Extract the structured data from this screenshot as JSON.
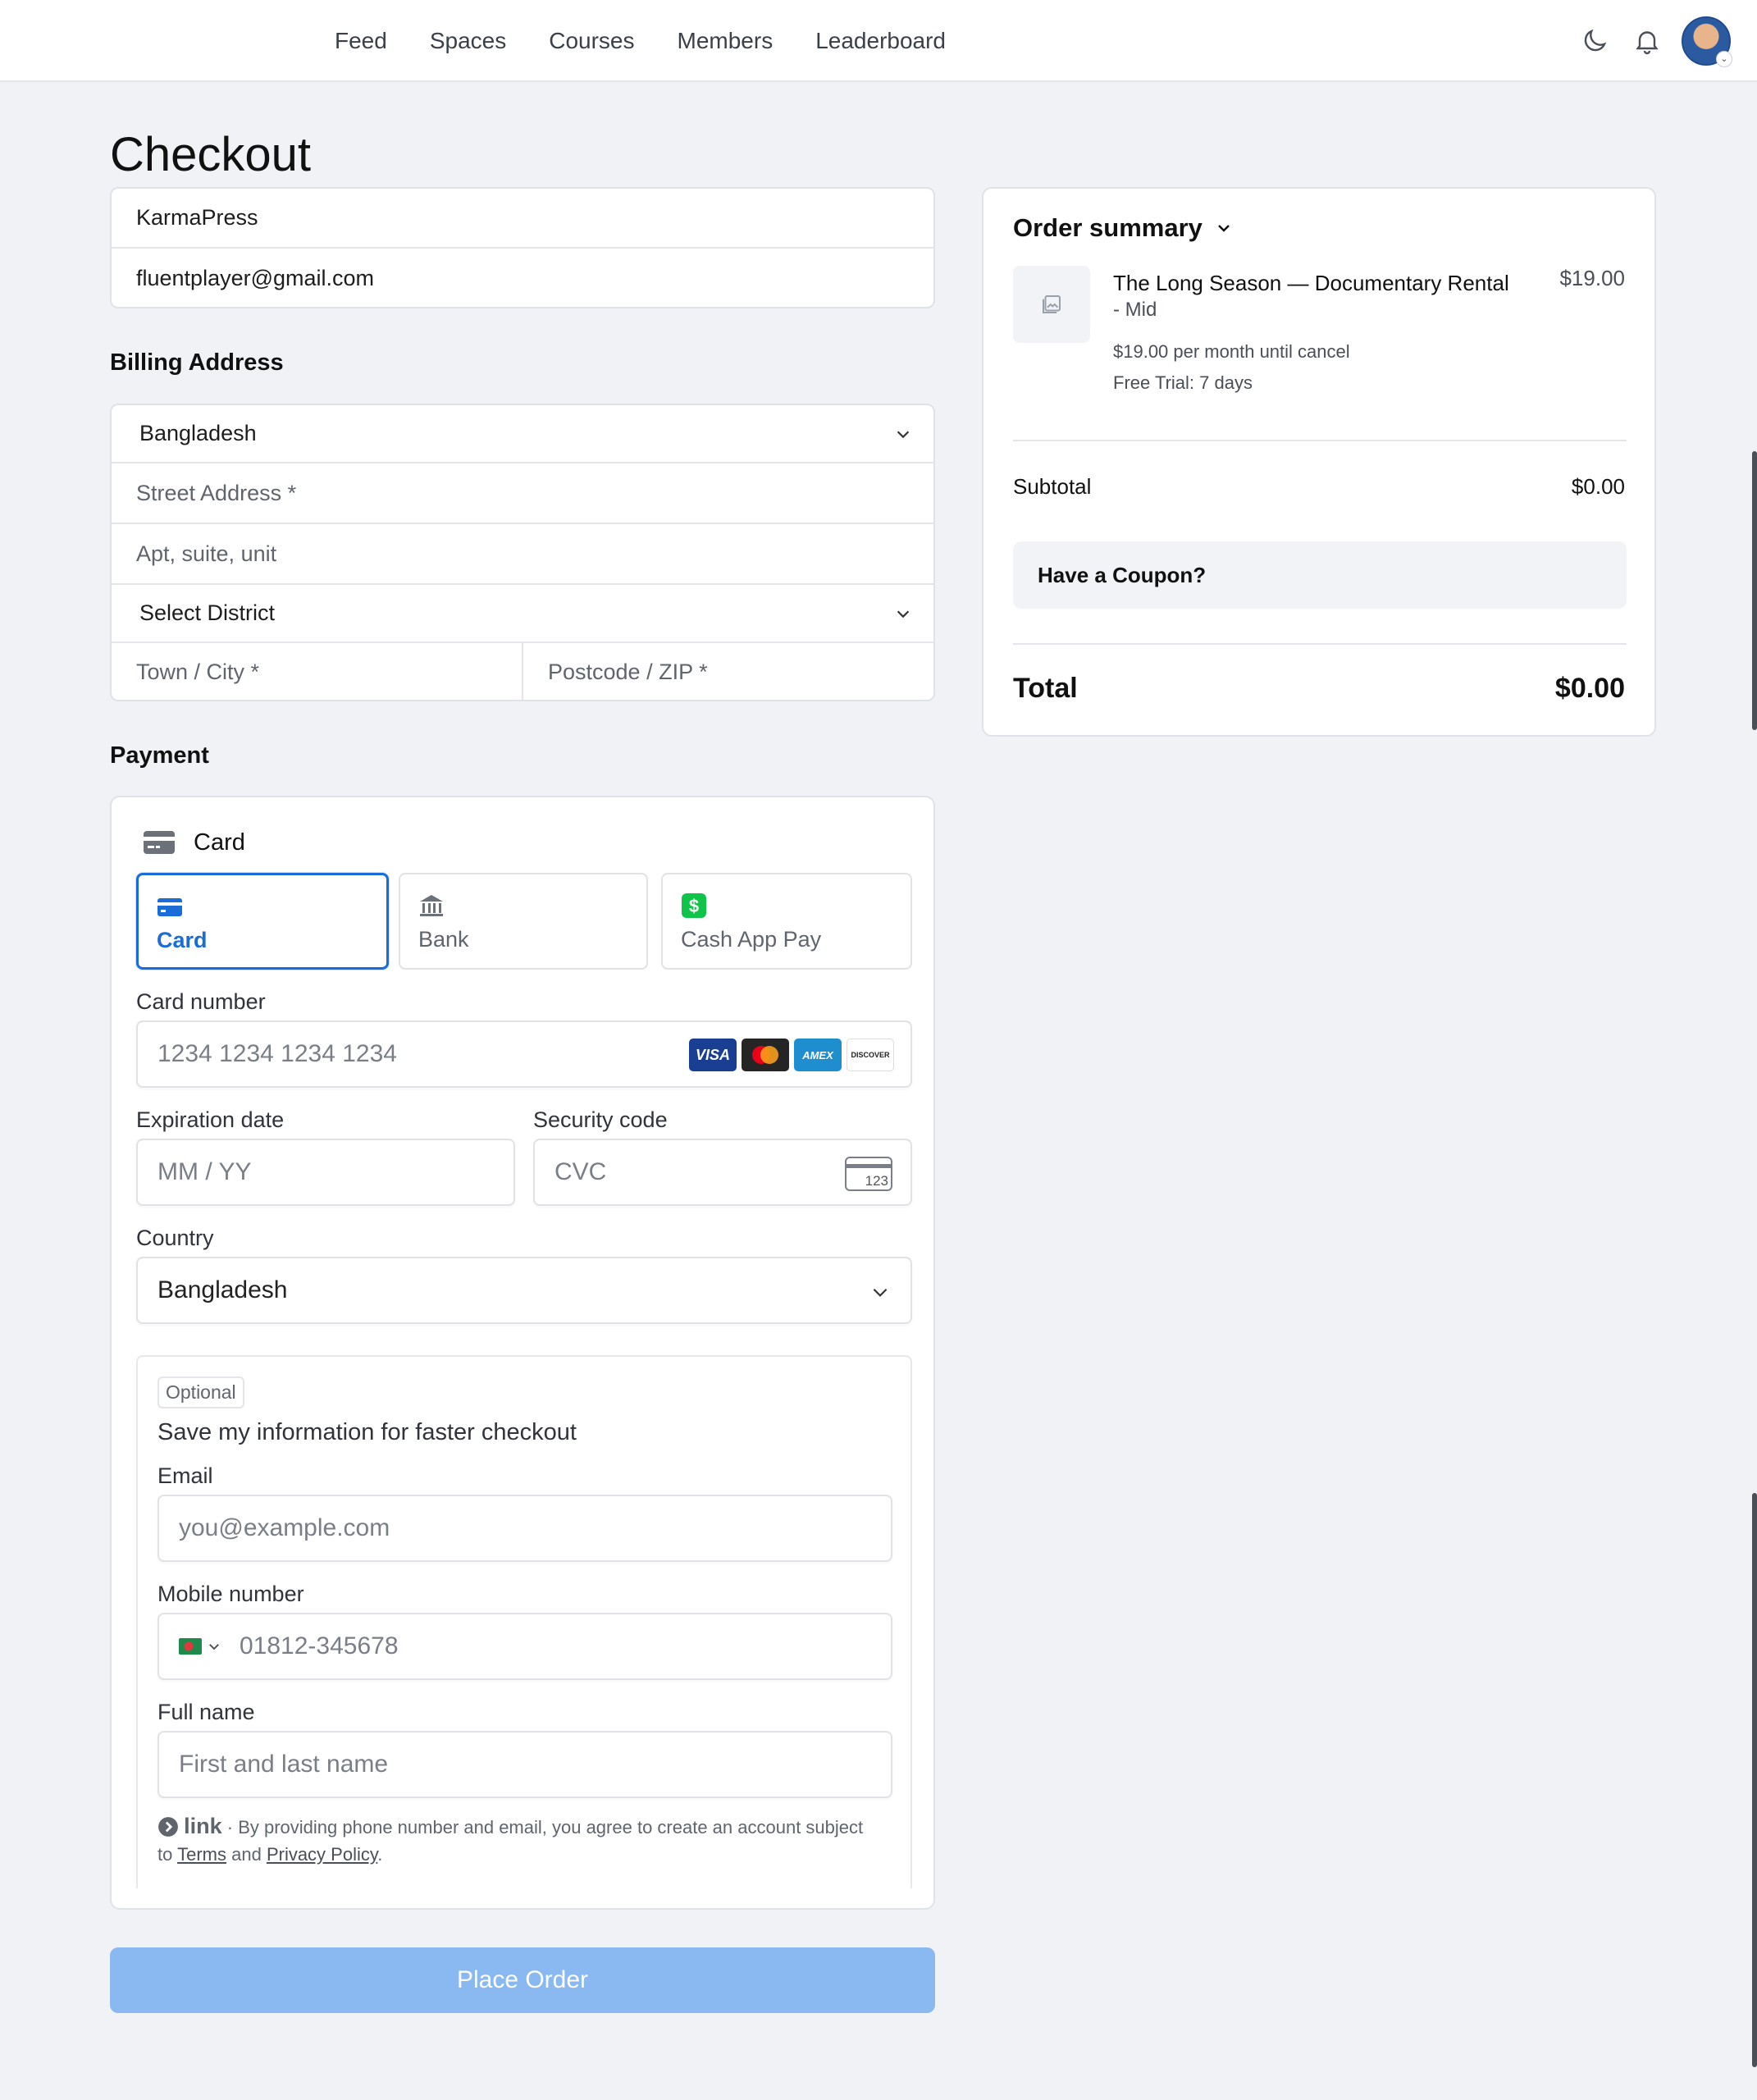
{
  "nav": {
    "links": [
      "Feed",
      "Spaces",
      "Courses",
      "Members",
      "Leaderboard"
    ]
  },
  "page": {
    "title": "Checkout"
  },
  "account": {
    "name_value": "KarmaPress",
    "email_value": "fluentplayer@gmail.com"
  },
  "billing": {
    "heading": "Billing Address",
    "country": "Bangladesh",
    "street_placeholder": "Street Address *",
    "apt_placeholder": "Apt, suite, unit",
    "district": "Select District",
    "city_placeholder": "Town / City *",
    "zip_placeholder": "Postcode / ZIP *"
  },
  "payment": {
    "heading": "Payment",
    "method_title": "Card",
    "tabs": [
      {
        "label": "Card",
        "icon": "card-icon"
      },
      {
        "label": "Bank",
        "icon": "bank-icon"
      },
      {
        "label": "Cash App Pay",
        "icon": "cash-app-icon"
      }
    ],
    "card_number_label": "Card number",
    "card_number_placeholder": "1234 1234 1234 1234",
    "brands": [
      "VISA",
      "AMEX",
      "DISCOVER"
    ],
    "expiry_label": "Expiration date",
    "expiry_placeholder": "MM / YY",
    "cvc_label": "Security code",
    "cvc_placeholder": "CVC",
    "cvc_icon_text": "123",
    "country_label": "Country",
    "country_value": "Bangladesh",
    "save": {
      "badge": "Optional",
      "title": "Save my information for faster checkout",
      "email_label": "Email",
      "email_placeholder": "you@example.com",
      "mobile_label": "Mobile number",
      "mobile_placeholder": "01812-345678",
      "fullname_label": "Full name",
      "fullname_placeholder": "First and last name",
      "link_logo": "link",
      "legal_text": "· By providing phone number and email, you agree to create an account subject to",
      "terms": "Terms",
      "and": "and",
      "privacy": "Privacy Policy",
      "period": "."
    },
    "place_order": "Place Order"
  },
  "summary": {
    "title": "Order summary",
    "product_name": "The Long Season — Documentary Rental",
    "product_variant": "- Mid",
    "product_price": "$19.00",
    "recurring": "$19.00 per month until cancel",
    "trial": "Free Trial: 7 days",
    "subtotal_label": "Subtotal",
    "subtotal_value": "$0.00",
    "coupon_label": "Have a Coupon?",
    "total_label": "Total",
    "total_value": "$0.00"
  },
  "colors": {
    "accent": "#1a6dd6",
    "button_disabled": "#8ab8f0",
    "background": "#f0f2f6"
  }
}
